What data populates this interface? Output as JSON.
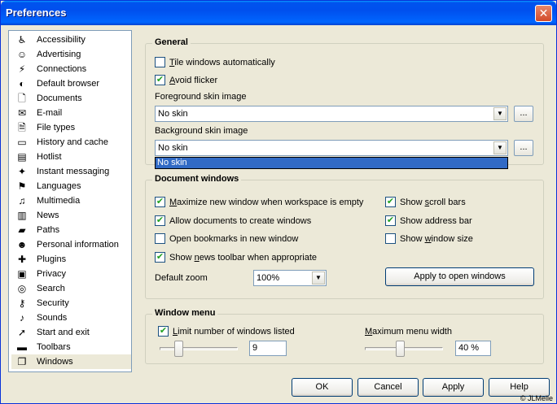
{
  "window": {
    "title": "Preferences"
  },
  "sidebar": {
    "items": [
      {
        "label": "Accessibility",
        "icon": "accessibility-icon",
        "glyph": "♿"
      },
      {
        "label": "Advertising",
        "icon": "smiley-icon",
        "glyph": "☺"
      },
      {
        "label": "Connections",
        "icon": "plug-icon",
        "glyph": "⚡"
      },
      {
        "label": "Default browser",
        "icon": "browser-icon",
        "glyph": "◐"
      },
      {
        "label": "Documents",
        "icon": "documents-icon",
        "glyph": "🗋"
      },
      {
        "label": "E-mail",
        "icon": "mail-icon",
        "glyph": "✉"
      },
      {
        "label": "File types",
        "icon": "file-types-icon",
        "glyph": "🗎"
      },
      {
        "label": "History and cache",
        "icon": "drive-icon",
        "glyph": "▭"
      },
      {
        "label": "Hotlist",
        "icon": "hotlist-icon",
        "glyph": "▤"
      },
      {
        "label": "Instant messaging",
        "icon": "messaging-icon",
        "glyph": "✦"
      },
      {
        "label": "Languages",
        "icon": "languages-icon",
        "glyph": "⚑"
      },
      {
        "label": "Multimedia",
        "icon": "multimedia-icon",
        "glyph": "♫"
      },
      {
        "label": "News",
        "icon": "news-icon",
        "glyph": "▥"
      },
      {
        "label": "Paths",
        "icon": "folder-icon",
        "glyph": "▰"
      },
      {
        "label": "Personal information",
        "icon": "person-icon",
        "glyph": "☻"
      },
      {
        "label": "Plugins",
        "icon": "plugins-icon",
        "glyph": "✚"
      },
      {
        "label": "Privacy",
        "icon": "privacy-icon",
        "glyph": "▣"
      },
      {
        "label": "Search",
        "icon": "search-icon",
        "glyph": "◎"
      },
      {
        "label": "Security",
        "icon": "key-icon",
        "glyph": "⚷"
      },
      {
        "label": "Sounds",
        "icon": "speaker-icon",
        "glyph": "♪"
      },
      {
        "label": "Start and exit",
        "icon": "start-exit-icon",
        "glyph": "➚"
      },
      {
        "label": "Toolbars",
        "icon": "toolbars-icon",
        "glyph": "▬"
      },
      {
        "label": "Windows",
        "icon": "windows-icon",
        "glyph": "❐"
      }
    ],
    "selected": "Windows"
  },
  "general": {
    "title": "General",
    "tile_windows": {
      "label": "Tile windows automatically",
      "checked": false
    },
    "avoid_flicker": {
      "label": "Avoid flicker",
      "checked": true
    },
    "fg_label": "Foreground skin image",
    "fg_value": "No skin",
    "bg_label": "Background skin image",
    "bg_value": "No skin",
    "browse_label": "...",
    "dropdown_option": "No skin"
  },
  "document_windows": {
    "title": "Document windows",
    "maximize": {
      "label": "Maximize new window when workspace is empty",
      "checked": true
    },
    "allow_create": {
      "label": "Allow documents to create windows",
      "checked": true
    },
    "open_bookmarks": {
      "label": "Open bookmarks in new window",
      "checked": false
    },
    "news_toolbar": {
      "label": "Show news toolbar when appropriate",
      "checked": true
    },
    "scroll_bars": {
      "label": "Show scroll bars",
      "checked": true
    },
    "address_bar": {
      "label": "Show address bar",
      "checked": true
    },
    "window_size": {
      "label": "Show window size",
      "checked": false
    },
    "zoom_label": "Default zoom",
    "zoom_value": "100%",
    "apply_open_label": "Apply to open windows"
  },
  "window_menu": {
    "title": "Window menu",
    "limit": {
      "label": "Limit number of windows listed",
      "checked": true
    },
    "limit_value": "9",
    "max_width_label": "Maximum menu width",
    "max_width_value": "40 %"
  },
  "buttons": {
    "ok": "OK",
    "cancel": "Cancel",
    "apply": "Apply",
    "help": "Help"
  },
  "footer": {
    "copyright": "© JLMelle"
  },
  "check_glyph": "✔"
}
